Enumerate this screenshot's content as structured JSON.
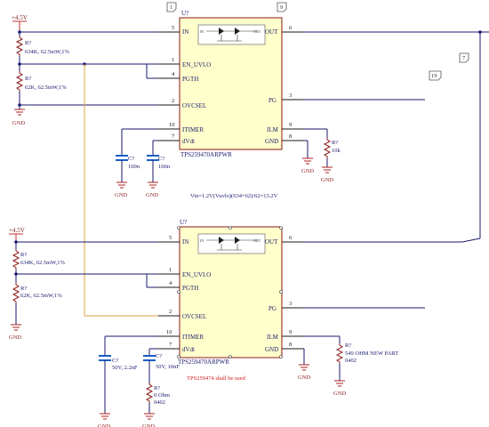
{
  "power": {
    "vcc": "+4.5V",
    "gnd": "GND"
  },
  "ic1": {
    "designator": "U?",
    "part": "TPS259470ARPWR",
    "pins_left": [
      {
        "num": "5",
        "name": "IN"
      },
      {
        "num": "1",
        "name": "EN_UVLO"
      },
      {
        "num": "4",
        "name": "PGTH"
      },
      {
        "num": "2",
        "name": "OVCSEL"
      },
      {
        "num": "10",
        "name": "ITIMER"
      },
      {
        "num": "7",
        "name": "dVdt"
      }
    ],
    "pins_right": [
      {
        "num": "6",
        "name": "OUT"
      },
      {
        "num": "3",
        "name": "PG"
      },
      {
        "num": "9",
        "name": "ILM"
      },
      {
        "num": "8",
        "name": "GND"
      }
    ],
    "inner": {
      "in": "IN",
      "out": "OUT"
    }
  },
  "ic2": {
    "designator": "U?",
    "part": "TPS259470ARPWR",
    "pins_left": [
      {
        "num": "5",
        "name": "IN"
      },
      {
        "num": "1",
        "name": "EN_UVLO"
      },
      {
        "num": "4",
        "name": "PGTH"
      },
      {
        "num": "2",
        "name": "OVCSEL"
      },
      {
        "num": "10",
        "name": "ITIMER"
      },
      {
        "num": "7",
        "name": "dVdt"
      }
    ],
    "pins_right": [
      {
        "num": "6",
        "name": "OUT"
      },
      {
        "num": "3",
        "name": "PG"
      },
      {
        "num": "9",
        "name": "ILM"
      },
      {
        "num": "8",
        "name": "GND"
      }
    ],
    "inner": {
      "in": "IN",
      "out": "OUT"
    }
  },
  "components": {
    "r1": {
      "ref": "R?",
      "value": "634K, 62.5mW,1%"
    },
    "r2": {
      "ref": "R?",
      "value": "62K, 62.5mW,1%"
    },
    "c1": {
      "ref": "C?",
      "value": "100n"
    },
    "c2": {
      "ref": "C?",
      "value": "100n"
    },
    "r3": {
      "ref": "R?",
      "value": "10k"
    },
    "r4": {
      "ref": "R?",
      "value": "634K, 62.5mW,1%"
    },
    "r5": {
      "ref": "R?",
      "value": "62K, 62.5mW,1%"
    },
    "c3": {
      "ref": "C?",
      "value": "50V, 2.2nF"
    },
    "c4": {
      "ref": "C?",
      "value": "50V, 10nF"
    },
    "r6": {
      "ref": "R?",
      "value": "0 Ohm",
      "package": "0402"
    },
    "r7": {
      "ref": "R?",
      "value": "549 OHM NEW PART",
      "package": "0402"
    }
  },
  "notes": {
    "formula": "Vin=1.2V(Vuvlo)(634+62)/62=13.2V",
    "warning": "TPS259474 shall be used"
  },
  "flags": [
    "1",
    "9",
    "19",
    "7"
  ],
  "colors": {
    "wire": "#1a1a6e",
    "net_orange": "#e0a040",
    "ic_fill": "#ffffcc",
    "ic_border": "#8b1a1a",
    "cap": "#1a5fc4",
    "warning": "#d42020"
  }
}
